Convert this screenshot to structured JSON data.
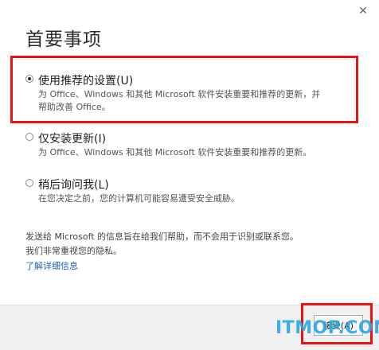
{
  "dialog": {
    "title": "首要事项",
    "close_icon": "close-icon"
  },
  "options": [
    {
      "label": "使用推荐的设置(U)",
      "desc_line1": "为 Office、Windows 和其他 Microsoft 软件安装重要和推荐的更新，并",
      "desc_line2": "帮助改善 Office。",
      "selected": true
    },
    {
      "label": "仅安装更新(I)",
      "desc_line1": "为 Office、Windows 和其他 Microsoft 软件安装重要和推荐的更新。",
      "selected": false
    },
    {
      "label": "稍后询问我(L)",
      "desc_line1": "在您决定之前，您的计算机可能容易遭受安全威胁。",
      "selected": false
    }
  ],
  "info": {
    "line1": "发送给 Microsoft 的信息旨在给我们帮助，而不会用于识别或联系您。",
    "line2": "我们非常重视您的隐私。",
    "link": "了解详细信息"
  },
  "footer": {
    "accept_label": "接受(A)"
  },
  "watermark": "ITMOP.COM",
  "colors": {
    "highlight": "#e8140f",
    "link": "#1e62b8",
    "watermark": "#2aa7e0"
  }
}
